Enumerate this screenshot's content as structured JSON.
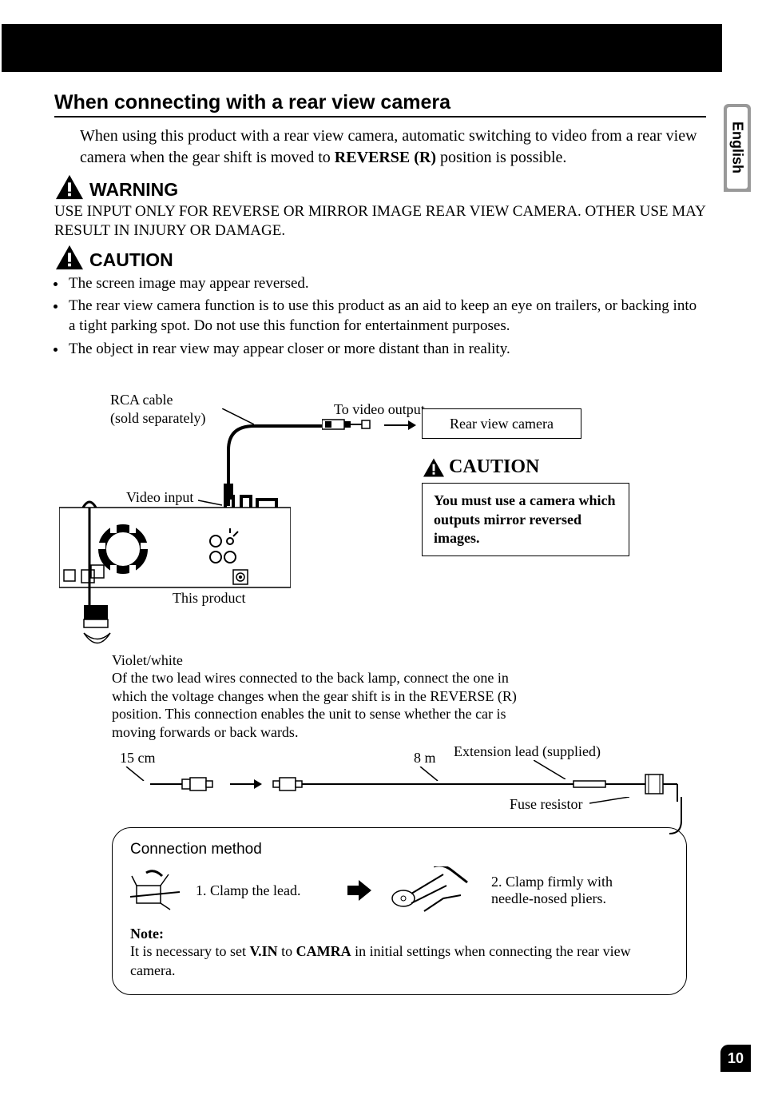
{
  "language_tab": "English",
  "page_number": "10",
  "title": "When connecting with a rear view camera",
  "intro_pre": "When using this product with a rear view camera, automatic switching to video from a rear view camera when the gear shift is moved to ",
  "intro_bold": "REVERSE (R)",
  "intro_post": " position is possible.",
  "warning_label": "WARNING",
  "warning_text": "USE INPUT ONLY FOR REVERSE OR MIRROR IMAGE REAR VIEW CAMERA. OTHER USE MAY RESULT IN INJURY OR DAMAGE.",
  "caution_label": "CAUTION",
  "bullets": [
    "The screen image may appear reversed.",
    "The rear view camera function is to use this product as an aid to keep an eye on trailers, or backing into a tight parking spot. Do not use this function for entertainment purposes.",
    "The object in rear view may appear closer or more distant than in reality."
  ],
  "diagram": {
    "rca_cable_1": "RCA cable",
    "rca_cable_2": "(sold separately)",
    "to_video_output": "To video output",
    "rear_view_camera": "Rear view camera",
    "video_input": "Video input",
    "this_product": "This product",
    "caution_head": "CAUTION",
    "caution_body": "You must use a camera which outputs mirror reversed images.",
    "violet_white": "Violet/white",
    "violet_desc": "Of the two lead wires connected to the back lamp, connect the one in which the voltage changes when the gear shift is in the REVERSE (R) position. This connection enables the unit to sense whether the  car is moving forwards or back wards.",
    "len_15cm": "15 cm",
    "len_8m": "8 m",
    "extension_lead": "Extension lead (supplied)",
    "fuse_resistor": "Fuse resistor",
    "conn_method": "Connection method",
    "step1": "1. Clamp the lead.",
    "step2": "2. Clamp firmly with needle-nosed pliers.",
    "note_label": "Note:",
    "note_pre": "It is necessary to set ",
    "note_b1": "V.IN",
    "note_mid": " to ",
    "note_b2": "CAMRA",
    "note_post": " in initial settings when connecting the rear view camera."
  }
}
